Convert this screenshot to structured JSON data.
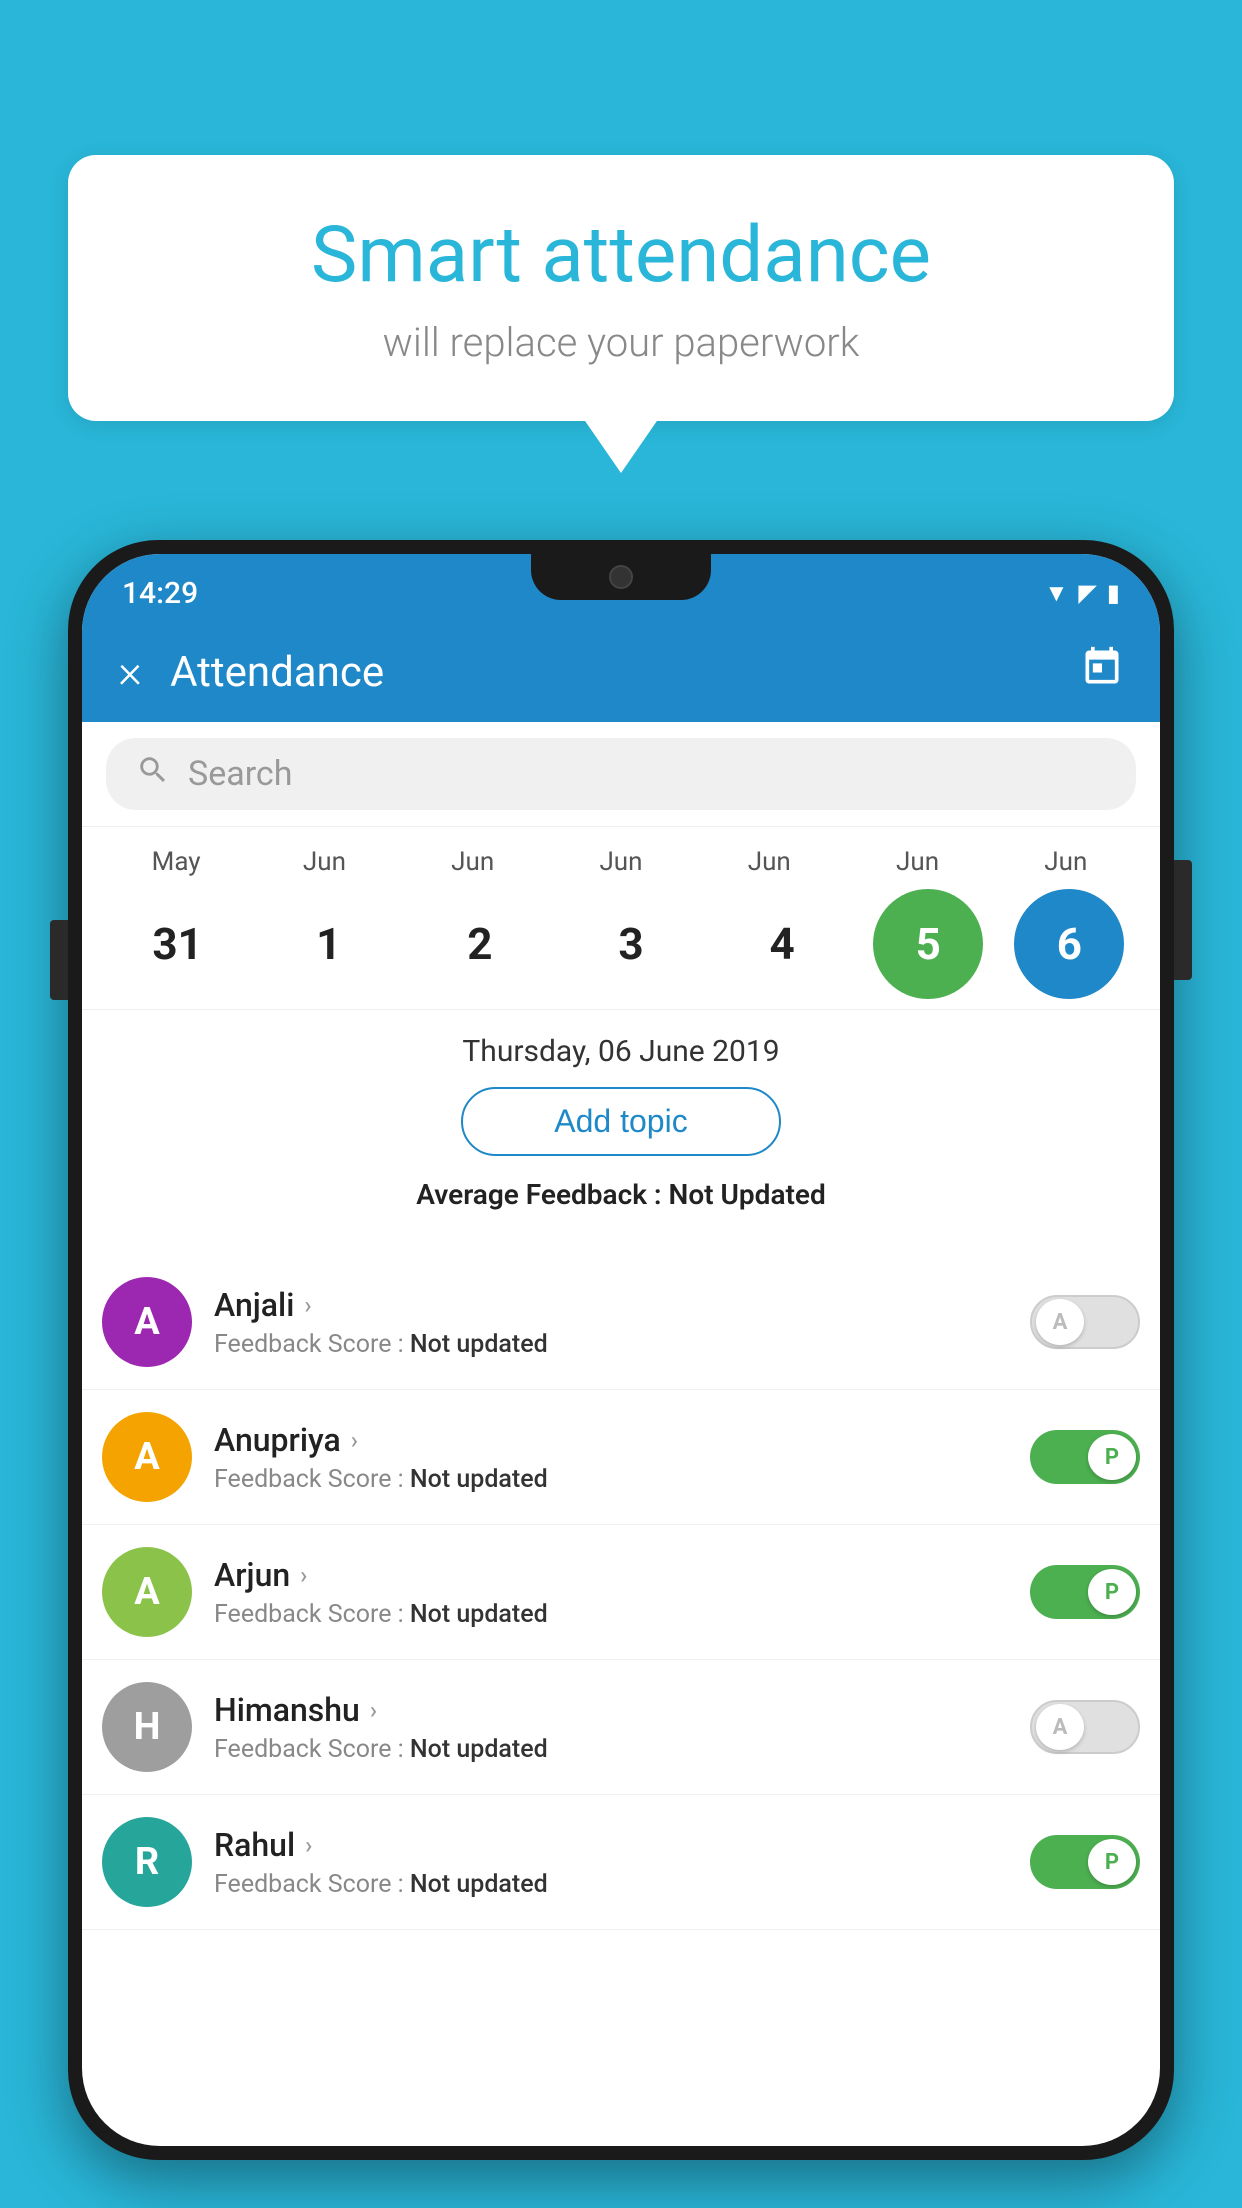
{
  "background_color": "#29b6d8",
  "speech_bubble": {
    "title": "Smart attendance",
    "subtitle": "will replace your paperwork"
  },
  "status_bar": {
    "time": "14:29",
    "wifi": "▼",
    "signal": "▲",
    "battery": "▮"
  },
  "header": {
    "title": "Attendance",
    "close_label": "×",
    "calendar_icon": "📅"
  },
  "search": {
    "placeholder": "Search"
  },
  "calendar": {
    "months": [
      "May",
      "Jun",
      "Jun",
      "Jun",
      "Jun",
      "Jun",
      "Jun"
    ],
    "dates": [
      "31",
      "1",
      "2",
      "3",
      "4",
      "5",
      "6"
    ],
    "states": [
      "normal",
      "normal",
      "normal",
      "normal",
      "normal",
      "today",
      "selected"
    ]
  },
  "selected_date": {
    "label": "Thursday, 06 June 2019",
    "add_topic": "Add topic",
    "avg_feedback_label": "Average Feedback :",
    "avg_feedback_value": "Not Updated"
  },
  "students": [
    {
      "name": "Anjali",
      "avatar_letter": "A",
      "avatar_color": "#9c27b0",
      "feedback_label": "Feedback Score :",
      "feedback_value": "Not updated",
      "attendance": "A",
      "toggle_state": "off"
    },
    {
      "name": "Anupriya",
      "avatar_letter": "A",
      "avatar_color": "#f4a300",
      "feedback_label": "Feedback Score :",
      "feedback_value": "Not updated",
      "attendance": "P",
      "toggle_state": "on"
    },
    {
      "name": "Arjun",
      "avatar_letter": "A",
      "avatar_color": "#8bc34a",
      "feedback_label": "Feedback Score :",
      "feedback_value": "Not updated",
      "attendance": "P",
      "toggle_state": "on"
    },
    {
      "name": "Himanshu",
      "avatar_letter": "H",
      "avatar_color": "#9e9e9e",
      "feedback_label": "Feedback Score :",
      "feedback_value": "Not updated",
      "attendance": "A",
      "toggle_state": "off"
    },
    {
      "name": "Rahul",
      "avatar_letter": "R",
      "avatar_color": "#26a69a",
      "feedback_label": "Feedback Score :",
      "feedback_value": "Not updated",
      "attendance": "P",
      "toggle_state": "on"
    }
  ]
}
